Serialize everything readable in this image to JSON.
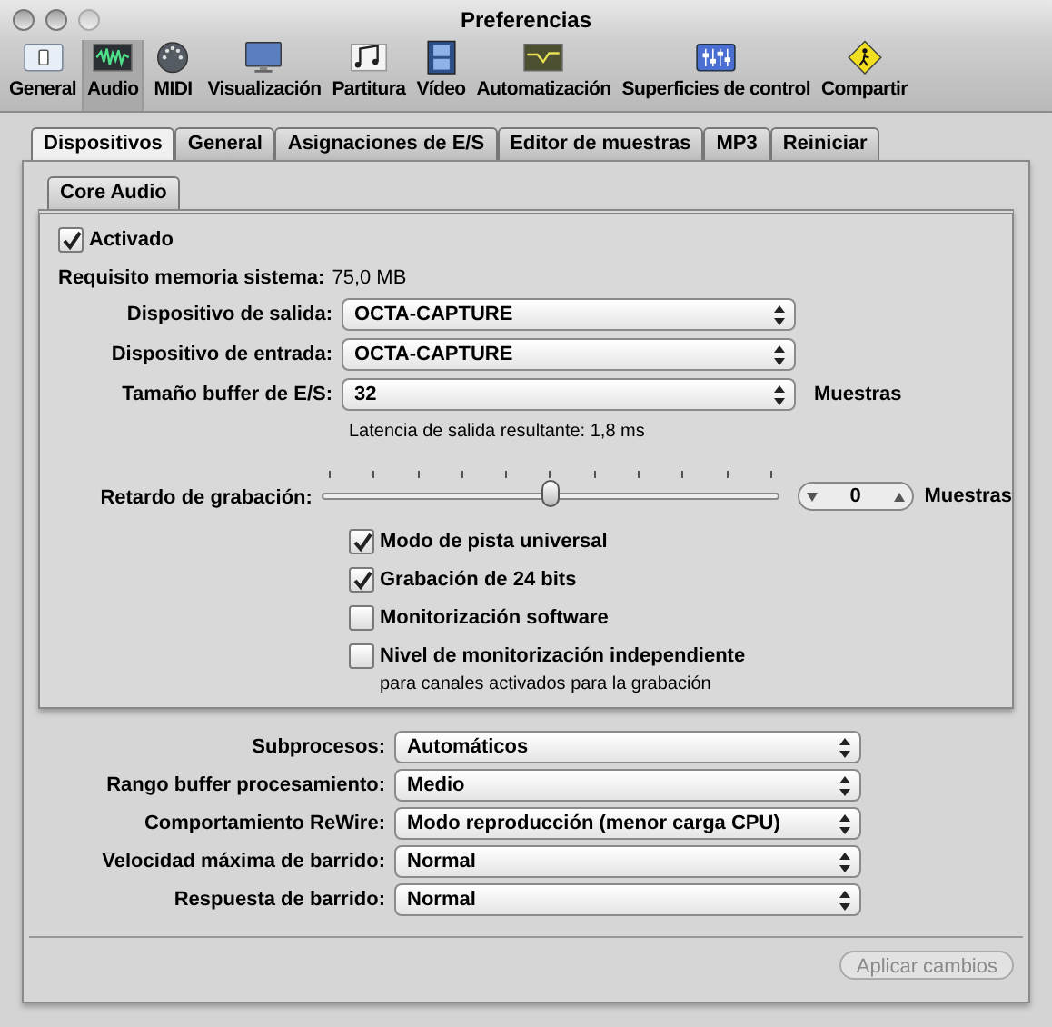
{
  "window": {
    "title": "Preferencias"
  },
  "toolbar": [
    {
      "label": "General",
      "selected": false,
      "kind": "general"
    },
    {
      "label": "Audio",
      "selected": true,
      "kind": "audio"
    },
    {
      "label": "MIDI",
      "selected": false,
      "kind": "midi"
    },
    {
      "label": "Visualización",
      "selected": false,
      "kind": "display"
    },
    {
      "label": "Partitura",
      "selected": false,
      "kind": "score"
    },
    {
      "label": "Vídeo",
      "selected": false,
      "kind": "video"
    },
    {
      "label": "Automatización",
      "selected": false,
      "kind": "automation"
    },
    {
      "label": "Superficies de control",
      "selected": false,
      "kind": "control"
    },
    {
      "label": "Compartir",
      "selected": false,
      "kind": "share"
    }
  ],
  "tabs": [
    {
      "label": "Dispositivos",
      "selected": true
    },
    {
      "label": "General",
      "selected": false
    },
    {
      "label": "Asignaciones de E/S",
      "selected": false
    },
    {
      "label": "Editor de muestras",
      "selected": false
    },
    {
      "label": "MP3",
      "selected": false
    },
    {
      "label": "Reiniciar",
      "selected": false
    }
  ],
  "core_audio": {
    "tab": "Core Audio",
    "enabled": {
      "label": "Activado",
      "checked": true
    },
    "memory": {
      "label": "Requisito memoria sistema:",
      "value": "75,0 MB"
    },
    "popups": [
      {
        "label": "Dispositivo de salida:",
        "value": "OCTA-CAPTURE"
      },
      {
        "label": "Dispositivo de entrada:",
        "value": "OCTA-CAPTURE"
      },
      {
        "label": "Tamaño buffer de E/S:",
        "value": "32",
        "unit": "Muestras"
      }
    ],
    "latency": "Latencia de salida resultante: 1,8 ms",
    "delay": {
      "label": "Retardo de grabación:",
      "level": 0.5,
      "value": "0",
      "unit": "Muestras"
    },
    "options": [
      {
        "label": "Modo de pista universal",
        "checked": true
      },
      {
        "label": "Grabación de 24 bits",
        "checked": true
      },
      {
        "label": "Monitorización software",
        "checked": false
      },
      {
        "label": "Nivel de monitorización independiente",
        "note": "para canales activados para la grabación",
        "checked": false
      }
    ]
  },
  "settings": [
    {
      "label": "Subprocesos:",
      "value": "Automáticos"
    },
    {
      "label": "Rango buffer procesamiento:",
      "value": "Medio"
    },
    {
      "label": "Comportamiento ReWire:",
      "value": "Modo reproducción (menor carga CPU)"
    },
    {
      "label": "Velocidad máxima de barrido:",
      "value": "Normal"
    },
    {
      "label": "Respuesta de barrido:",
      "value": "Normal"
    }
  ],
  "apply_button": {
    "label": "Aplicar cambios",
    "disabled": true
  }
}
